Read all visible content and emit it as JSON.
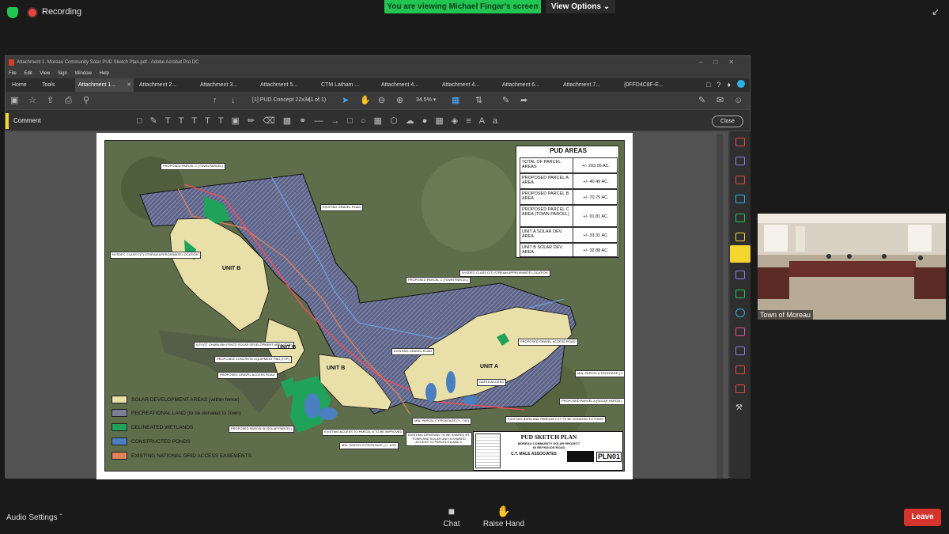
{
  "meeting": {
    "recording_label": "Recording",
    "viewing_banner": "You are viewing Michael Fingar's screen",
    "view_options_label": "View Options",
    "audio_settings_label": "Audio Settings",
    "chat_label": "Chat",
    "raise_hand_label": "Raise Hand",
    "leave_label": "Leave",
    "participant_name": "Town of Moreau",
    "colors": {
      "green": "#23c552",
      "leave": "#d4342c"
    }
  },
  "acrobat": {
    "window_title": "Attachment 1. Moreau Community Solar PUD Sketch Plan.pdf - Adobe Acrobat Pro DC",
    "menu": [
      "File",
      "Edit",
      "View",
      "Sign",
      "Window",
      "Help"
    ],
    "nav": [
      "Home",
      "Tools"
    ],
    "tabs": [
      "Attachment 1...",
      "Attachment 2...",
      "Attachment 3...",
      "Attachment 5...",
      "CTM Latham ...",
      "Attachment 4...",
      "Attachment 4...",
      "Attachment 6...",
      "Attachment 7...",
      "{0FFD4C8F-E..."
    ],
    "page_label": "[1] PUD Concept 22x34",
    "page_count": "(1 of 1)",
    "zoom": "34.5%",
    "comment_label": "Comment",
    "close_label": "Close"
  },
  "plan": {
    "areas_title": "PUD AREAS",
    "areas": [
      {
        "name": "TOTAL OF PARCEL AREAS",
        "value": "+/- 203.05 AC."
      },
      {
        "name": "PROPOSED PARCEL A AREA",
        "value": "+/- 40.49 AC."
      },
      {
        "name": "PROPOSED PARCEL B AREA",
        "value": "+/- 70.75 AC."
      },
      {
        "name": "PROPOSED PARCEL C AREA (TOWN PARCEL)",
        "value": "+/- 91.81 AC."
      },
      {
        "name": "UNIT A SOLAR DEV. AREA",
        "value": "+/- 33.31 AC."
      },
      {
        "name": "UNIT B SOLAR DEV. AREA",
        "value": "+/- 32.88 AC."
      }
    ],
    "legend": [
      {
        "label": "SOLAR DEVELOPMENT AREAS (within fence)",
        "color": "#e8e0a8"
      },
      {
        "label": "RECREATIONAL LAND (to be donated to Town)",
        "color": "#7a7f96"
      },
      {
        "label": "DELINEATED WETLANDS",
        "color": "#1fa35a"
      },
      {
        "label": "CONSTRUCTED PONDS",
        "color": "#4a7fc0"
      },
      {
        "label": "EXISTING NATIONAL GRID ACCESS EASEMENTS",
        "color": "#e0825a"
      }
    ],
    "units": {
      "b1": "UNIT B",
      "b2": "UNIT B",
      "b3": "UNIT B",
      "a": "UNIT A"
    },
    "callouts": {
      "c1": "PROPOSED PARCEL C (TOWN PARCEL)",
      "c2": "EXISTING GRAVEL ROAD",
      "c3": "NYSDEC CLASS C(T) STREAM APPROXIMATE LOCATION",
      "c4": "PROPOSED PARCEL C (TOWN PARCEL)",
      "c5": "NYSDEC CLASS C(T) STREAM APPROXIMATE LOCATION",
      "c6": "6-FOOT CHAINLINK FENCE SOLAR DEVELOPMENT AREA (TYP.)",
      "c7": "PROPOSED CONCRETE EQUIPMENT PAD (TYP.)",
      "c8": "PROPOSED GRAVEL ACCESS ROAD",
      "c9": "EXISTING GRAVEL ROAD",
      "c10": "PROPOSED GRAVEL ACCESS ROAD",
      "c11": "GATED ACCESS",
      "c12": "MIN. PARCEL A FRONTAGE (+/- 1,083')",
      "c13": "PROPOSED PARCEL A (SOLAR PARCEL)",
      "c14": "EXISTING BARN AND PARKING LOT TO BE DONATED TO TOWN",
      "c15": "MIN. PARCEL C FRONTAGE (+/- 740')",
      "c16": "EXISTING DRIVEWAY TO BE SHARED BY TOWN AND SOLAR UNIT A SHARED ACCESS TO PARCELS A AND C",
      "c17": "EXISTING ACCESS TO PARCEL B TO BE IMPROVED",
      "c18": "MIN. PARCEL B FRONTAGE (+/- 125')",
      "c19": "PROPOSED PARCEL B (SOLAR PARCEL)"
    },
    "title_block": {
      "title": "PUD SKETCH PLAN",
      "subtitle": "MOREAU COMMUNITY SOLAR PROJECT",
      "address": "66 REYNOLDS ROAD",
      "firm": "C.T. MALE ASSOCIATES",
      "sheet": "PLN01"
    }
  }
}
